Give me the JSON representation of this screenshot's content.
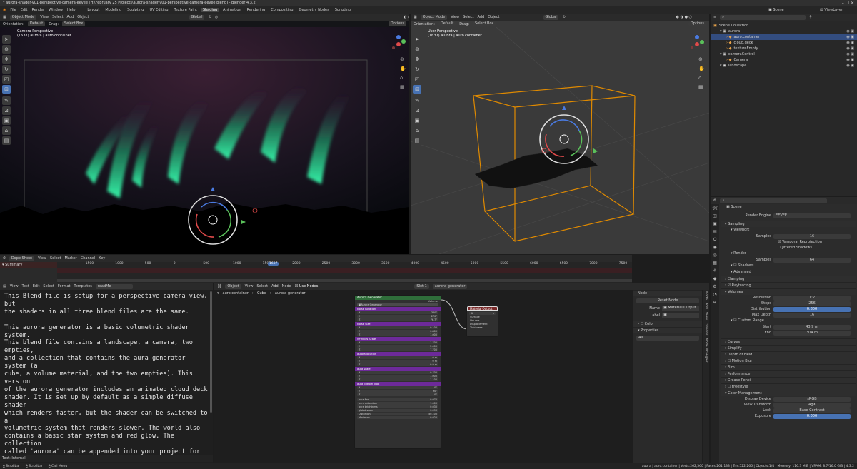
{
  "window": {
    "title": "* aurora-shader-v01-perspective-camera-eevee [H:\\February 25 Projects\\aurora-shader-v01-perspective-camera-eevee.blend] - Blender 4.3.2",
    "controls": "–  ☐  ✕"
  },
  "menubar": {
    "items": [
      "File",
      "Edit",
      "Render",
      "Window",
      "Help"
    ],
    "workspaces": [
      "Layout",
      "Modeling",
      "Sculpting",
      "UV Editing",
      "Texture Paint",
      "Shading",
      "Animation",
      "Rendering",
      "Compositing",
      "Geometry Nodes",
      "Scripting"
    ],
    "active_workspace": "Shading",
    "scene_label": "Scene",
    "viewlayer_label": "ViewLayer"
  },
  "viewport_left": {
    "mode": "Object Mode",
    "menus": [
      "View",
      "Select",
      "Add",
      "Object"
    ],
    "transform": "Global",
    "orientation_label": "Orientation:",
    "orientation": "Default",
    "drag_label": "Drag:",
    "drag": "Select Box",
    "options": "Options",
    "info_line1": "Camera Perspective",
    "info_line2": "(1637) aurora | auro.container"
  },
  "viewport_right": {
    "mode": "Object Mode",
    "menus": [
      "View",
      "Select",
      "Add",
      "Object"
    ],
    "transform": "Global",
    "orientation_label": "Orientation:",
    "orientation": "Default",
    "drag_label": "Drag:",
    "drag": "Select Box",
    "options": "Options",
    "info_line1": "User Perspective",
    "info_line2": "(1637) aurora | auro.container"
  },
  "outliner": {
    "rows": [
      {
        "label": "Scene Collection",
        "indent": 0,
        "selected": false
      },
      {
        "label": "aurora",
        "indent": 1,
        "selected": false
      },
      {
        "label": "auro.container",
        "indent": 2,
        "selected": true
      },
      {
        "label": "cloud.deck",
        "indent": 2,
        "selected": false
      },
      {
        "label": "textureEmpty",
        "indent": 2,
        "selected": false
      },
      {
        "label": "cameraControl",
        "indent": 1,
        "selected": false
      },
      {
        "label": "Camera",
        "indent": 2,
        "selected": false
      },
      {
        "label": "landscape",
        "indent": 1,
        "selected": false
      }
    ]
  },
  "dopesheet": {
    "editor": "Dope Sheet",
    "menus": [
      "View",
      "Select",
      "Marker",
      "Channel",
      "Key"
    ],
    "summary": "Summary",
    "ticks": [
      "-1500",
      "-1000",
      "-500",
      "0",
      "500",
      "1000",
      "1500",
      "2000",
      "2500",
      "3000",
      "3500",
      "4000",
      "4500",
      "5000",
      "5500",
      "6000",
      "6500",
      "7000",
      "7500"
    ],
    "current_frame": "1637"
  },
  "text_editor": {
    "menus": [
      "View",
      "Text",
      "Edit",
      "Select",
      "Format",
      "Templates"
    ],
    "filename": "readMe",
    "body": "This Blend file is setup for a perspective camera view, but\nthe shaders in all three blend files are the same.\n\nThis aurora generator is a basic volumetric shader system.\nThis blend file contains a landscape, a camera, two empties,\nand a collection that contains the aura generator system (a\ncube, a volume material, and the two empties). This version\nof the aurora generator includes an animated cloud deck\nshader. It is set up by default as a simple diffuse shader\nwhich renders faster, but the shader can be switched to a\nvolumetric system that renders slower. The world also\ncontains a basic star system and red glow. The collection\ncalled 'aurora' can be appended into your project for easy\nintegration into your scene. The system is animated using\nextrapolated keyframes on the main mapping node inside the\nmain shader group. You probably won't need to adjust them.\nThere are also an empty that controls the locations of a\nnoise texture that ripples through the aura. Changing both\nof these keyframes will change the speed of the rippling and\nundulating of the aurora.",
    "footer": "Text: Internal"
  },
  "node_editor": {
    "menus": [
      "View",
      "Select",
      "Add",
      "Node"
    ],
    "object": "Object",
    "use_nodes": "Use Nodes",
    "slot": "Slot 1",
    "material": "aurora generator",
    "breadcrumb": [
      "auro.container",
      "Cube",
      "aurora generator"
    ],
    "group_node": {
      "title": "Aurora Generator",
      "name_field": "Aurora Generator",
      "output_label": "Volume",
      "sections": [
        {
          "label": "Noise Rotation",
          "rows": [
            [
              "X",
              "360°"
            ],
            [
              "Y",
              "270°"
            ],
            [
              "Z",
              "76.7°"
            ]
          ]
        },
        {
          "label": "Noise Size",
          "rows": [
            [
              "X",
              "0.100"
            ],
            [
              "Y",
              "0.800"
            ],
            [
              "Z",
              "1.000"
            ]
          ]
        },
        {
          "label": "Wrinkles Scale",
          "rows": [
            [
              "X",
              "1.700"
            ],
            [
              "Y",
              "2.400"
            ],
            [
              "Z",
              "7.700"
            ]
          ]
        },
        {
          "label": "aurora location",
          "rows": [
            [
              "X",
              "0 m"
            ],
            [
              "Y",
              "0 m"
            ],
            [
              "Z",
              "-0.9 m"
            ]
          ]
        },
        {
          "label": "aura scale",
          "rows": [
            [
              "X",
              "0.700"
            ],
            [
              "Y",
              "1.000"
            ],
            [
              "Z",
              "1.100"
            ]
          ]
        },
        {
          "label": "aura bottom crop",
          "rows": [
            [
              "X",
              "0°"
            ],
            [
              "Y",
              "90°"
            ],
            [
              "Z",
              "0°"
            ]
          ]
        }
      ],
      "extras": [
        [
          "aura fine",
          "0.070"
        ],
        [
          "aura saturation",
          "1.000"
        ],
        [
          "aura brightness",
          "0.030"
        ],
        [
          "global scale",
          "0.090"
        ],
        [
          "Distortion",
          "50.100"
        ],
        [
          "Minimum",
          "0.025"
        ]
      ]
    },
    "output_node": {
      "title": "Material Output",
      "target": "All",
      "sockets": [
        "Surface",
        "Volume",
        "Displacement",
        "Thickness"
      ]
    },
    "sidebar": {
      "panel": "Node",
      "reset": "Reset Node",
      "name_label": "Name",
      "name_value": "Material Output",
      "label_label": "Label",
      "color": "Color",
      "properties": "Properties",
      "prop_value": "All",
      "tabs": [
        "Node",
        "Tool",
        "View",
        "Options",
        "Node Wrangler"
      ]
    }
  },
  "properties": {
    "scene": "Scene",
    "render_engine_label": "Render Engine",
    "render_engine": "EEVEE",
    "rows": [
      {
        "type": "head",
        "label": "Sampling"
      },
      {
        "type": "sub",
        "label": "Viewport"
      },
      {
        "type": "field",
        "label": "Samples",
        "value": "16"
      },
      {
        "type": "check",
        "label": "Temporal Reprojection",
        "on": true
      },
      {
        "type": "check",
        "label": "Jittered Shadows",
        "on": false
      },
      {
        "type": "sub",
        "label": "Render"
      },
      {
        "type": "field",
        "label": "Samples",
        "value": "64"
      },
      {
        "type": "sub",
        "label": "Shadows",
        "check": true
      },
      {
        "type": "sub",
        "label": "Advanced"
      },
      {
        "type": "head",
        "label": "Clamping"
      },
      {
        "type": "head",
        "label": "Raytracing",
        "check": true
      },
      {
        "type": "head",
        "label": "Volumes"
      },
      {
        "type": "field",
        "label": "Resolution",
        "value": "1:2"
      },
      {
        "type": "field",
        "label": "Steps",
        "value": "256"
      },
      {
        "type": "field",
        "label": "Distribution",
        "value": "0.800",
        "blue": true
      },
      {
        "type": "field",
        "label": "Max Depth",
        "value": "16"
      },
      {
        "type": "sub",
        "label": "Custom Range",
        "check": true
      },
      {
        "type": "field",
        "label": "Start",
        "value": "43.9 m"
      },
      {
        "type": "field",
        "label": "End",
        "value": "304 m"
      },
      {
        "type": "gap"
      },
      {
        "type": "head",
        "label": "Curves"
      },
      {
        "type": "head",
        "label": "Simplify"
      },
      {
        "type": "head",
        "label": "Depth of Field"
      },
      {
        "type": "head",
        "label": "Motion Blur",
        "check": false
      },
      {
        "type": "head",
        "label": "Film"
      },
      {
        "type": "head",
        "label": "Performance"
      },
      {
        "type": "head",
        "label": "Grease Pencil"
      },
      {
        "type": "head",
        "label": "Freestyle",
        "check": false
      },
      {
        "type": "head",
        "label": "Color Management"
      },
      {
        "type": "field",
        "label": "Display Device",
        "value": "sRGB"
      },
      {
        "type": "field",
        "label": "View Transform",
        "value": "AgX"
      },
      {
        "type": "field",
        "label": "Look",
        "value": "Base Contrast"
      },
      {
        "type": "field",
        "label": "Exposure",
        "value": "0.000",
        "blue": true
      }
    ]
  },
  "statusbar": {
    "left": [
      "Scrollbar",
      "Scrollbar",
      "Call Menu"
    ],
    "right": "auora | auro.container | Verts:262,560 | Faces:261,133 | Tris:522,266 | Objects:1/4 | Memory: 116.3 MiB | VRAM: 8.7/16.0 GiB | 4.3.2"
  },
  "colors": {
    "accent": "#4772b3",
    "selection_orange": "#e08a00",
    "node_group_header": "#6d2a9a",
    "aurora_green": "#2fd08a"
  }
}
